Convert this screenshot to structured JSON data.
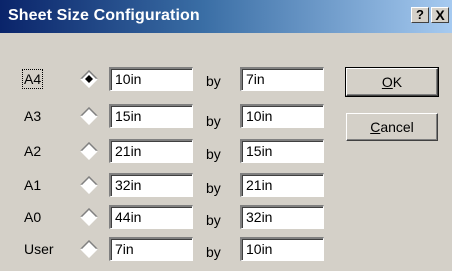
{
  "window": {
    "title": "Sheet Size Configuration",
    "help_button": "?",
    "close_button": "X"
  },
  "by_label": "by",
  "sizes": [
    {
      "label": "A4",
      "width": "10in",
      "height": "7in",
      "selected": true
    },
    {
      "label": "A3",
      "width": "15in",
      "height": "10in",
      "selected": false
    },
    {
      "label": "A2",
      "width": "21in",
      "height": "15in",
      "selected": false
    },
    {
      "label": "A1",
      "width": "32in",
      "height": "21in",
      "selected": false
    },
    {
      "label": "A0",
      "width": "44in",
      "height": "32in",
      "selected": false
    },
    {
      "label": "User",
      "width": "7in",
      "height": "10in",
      "selected": false
    }
  ],
  "buttons": {
    "ok_mnemonic": "O",
    "ok_rest": "K",
    "cancel_mnemonic": "C",
    "cancel_rest": "ancel"
  },
  "colors": {
    "titlebar_start": "#0a246a",
    "titlebar_end": "#a6caf0",
    "dialog_face": "#d4d0c8"
  }
}
